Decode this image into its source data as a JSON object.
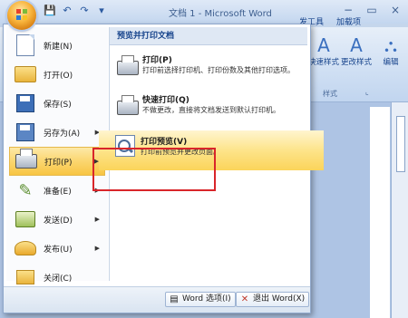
{
  "window": {
    "title": "文档 1 - Microsoft Word",
    "controls": [
      "−",
      "▭",
      "×"
    ]
  },
  "quick_access": [
    "save-icon",
    "undo-icon",
    "redo-icon",
    "customize-icon"
  ],
  "ribbon": {
    "tabs": [
      "发工具",
      "加载项"
    ],
    "buttons": [
      {
        "label": "快速样式",
        "icon": "A"
      },
      {
        "label": "更改样式",
        "icon": "A"
      },
      {
        "label": "编辑",
        "icon": "⛬"
      }
    ],
    "group_label": "样式",
    "group_launcher": "⌞"
  },
  "menu": {
    "left_items": [
      {
        "label": "新建(N)",
        "icon": "new-document-icon",
        "submenu": false,
        "active": false
      },
      {
        "label": "打开(O)",
        "icon": "open-folder-icon",
        "submenu": false,
        "active": false
      },
      {
        "label": "保存(S)",
        "icon": "save-disk-icon",
        "submenu": false,
        "active": false
      },
      {
        "label": "另存为(A)",
        "icon": "save-as-icon",
        "submenu": true,
        "active": false
      },
      {
        "label": "打印(P)",
        "icon": "printer-icon",
        "submenu": true,
        "active": true
      },
      {
        "label": "准备(E)",
        "icon": "prepare-icon",
        "submenu": true,
        "active": false
      },
      {
        "label": "发送(D)",
        "icon": "send-icon",
        "submenu": true,
        "active": false
      },
      {
        "label": "发布(U)",
        "icon": "publish-icon",
        "submenu": true,
        "active": false
      },
      {
        "label": "关闭(C)",
        "icon": "close-document-icon",
        "submenu": false,
        "active": false
      }
    ],
    "right_header": "预览并打印文档",
    "right_items": [
      {
        "title": "打印(P)",
        "desc": "打印前选择打印机、打印份数及其他打印选项。",
        "icon": "printer-icon",
        "active": false
      },
      {
        "title": "快速打印(Q)",
        "desc": "不做更改，直接将文档发送到默认打印机。",
        "icon": "quick-print-icon",
        "active": false
      },
      {
        "title": "打印预览(V)",
        "desc": "打印前预览并更改页面。",
        "icon": "print-preview-icon",
        "active": true
      }
    ],
    "footer": {
      "options_label": "Word 选项(I)",
      "exit_label": "退出 Word(X)"
    }
  }
}
